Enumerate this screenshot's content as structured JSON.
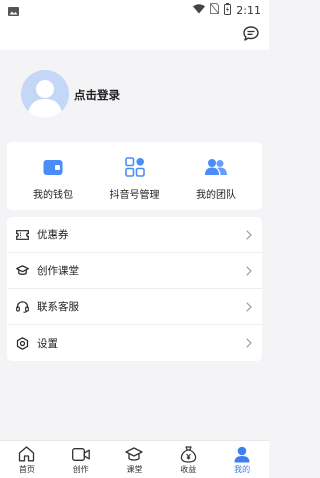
{
  "status_bar": {
    "time": "2:11",
    "icons": [
      "image-icon",
      "wifi-icon",
      "no-sim-icon",
      "battery-icon"
    ]
  },
  "header": {
    "message_icon": "chat-bubble-icon"
  },
  "profile": {
    "login_label": "点击登录",
    "avatar_icon": "default-avatar-icon"
  },
  "quick_actions": [
    {
      "label": "我的钱包",
      "icon": "wallet-icon"
    },
    {
      "label": "抖音号管理",
      "icon": "grid-apps-icon"
    },
    {
      "label": "我的团队",
      "icon": "team-icon"
    }
  ],
  "menu": [
    {
      "label": "优惠券",
      "icon": "coupon-icon"
    },
    {
      "label": "创作课堂",
      "icon": "graduation-cap-icon"
    },
    {
      "label": "联系客服",
      "icon": "headset-icon"
    },
    {
      "label": "设置",
      "icon": "settings-icon"
    }
  ],
  "tabbar": {
    "active_index": 4,
    "items": [
      {
        "label": "首页",
        "icon": "home-icon"
      },
      {
        "label": "创作",
        "icon": "video-camera-icon"
      },
      {
        "label": "课堂",
        "icon": "graduation-cap-icon"
      },
      {
        "label": "收益",
        "icon": "money-bag-icon"
      },
      {
        "label": "我的",
        "icon": "person-icon"
      }
    ]
  },
  "colors": {
    "accent": "#3d7fee",
    "icon_blue": "#4a8df8",
    "background": "#f4f4f6",
    "card": "#ffffff",
    "avatar_bg": "#c5d7f6"
  }
}
